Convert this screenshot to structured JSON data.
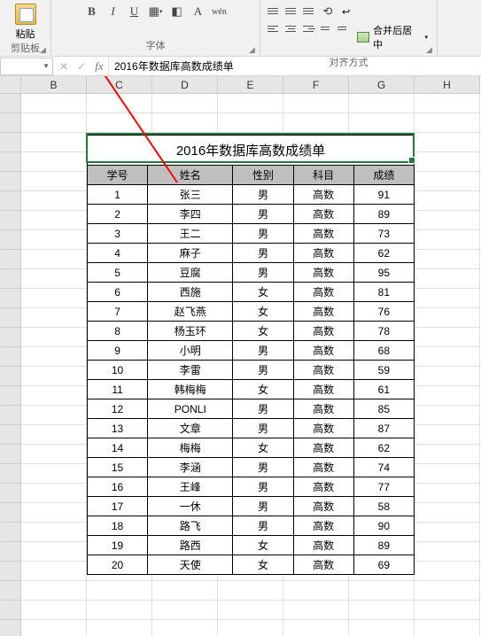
{
  "ribbon": {
    "clipboard": {
      "paste": "粘贴",
      "title": "剪贴板"
    },
    "font": {
      "title": "字体",
      "bold": "B",
      "italic": "I",
      "underline": "U"
    },
    "align": {
      "title": "对齐方式",
      "merge": "合并后居中"
    }
  },
  "formula_bar": {
    "cell_ref": "",
    "value": "2016年数据库高数成绩单"
  },
  "columns": [
    "B",
    "C",
    "D",
    "E",
    "F",
    "G",
    "H"
  ],
  "table": {
    "title": "2016年数据库高数成绩单",
    "headers": [
      "学号",
      "姓名",
      "性别",
      "科目",
      "成绩"
    ],
    "rows": [
      [
        "1",
        "张三",
        "男",
        "高数",
        "91"
      ],
      [
        "2",
        "李四",
        "男",
        "高数",
        "89"
      ],
      [
        "3",
        "王二",
        "男",
        "高数",
        "73"
      ],
      [
        "4",
        "麻子",
        "男",
        "高数",
        "62"
      ],
      [
        "5",
        "豆腐",
        "男",
        "高数",
        "95"
      ],
      [
        "6",
        "西施",
        "女",
        "高数",
        "81"
      ],
      [
        "7",
        "赵飞燕",
        "女",
        "高数",
        "76"
      ],
      [
        "8",
        "杨玉环",
        "女",
        "高数",
        "78"
      ],
      [
        "9",
        "小明",
        "男",
        "高数",
        "68"
      ],
      [
        "10",
        "李雷",
        "男",
        "高数",
        "59"
      ],
      [
        "11",
        "韩梅梅",
        "女",
        "高数",
        "61"
      ],
      [
        "12",
        "PONLI",
        "男",
        "高数",
        "85"
      ],
      [
        "13",
        "文章",
        "男",
        "高数",
        "87"
      ],
      [
        "14",
        "梅梅",
        "女",
        "高数",
        "62"
      ],
      [
        "15",
        "李涵",
        "男",
        "高数",
        "74"
      ],
      [
        "16",
        "王峰",
        "男",
        "高数",
        "77"
      ],
      [
        "17",
        "一休",
        "男",
        "高数",
        "58"
      ],
      [
        "18",
        "路飞",
        "男",
        "高数",
        "90"
      ],
      [
        "19",
        "路西",
        "女",
        "高数",
        "89"
      ],
      [
        "20",
        "天使",
        "女",
        "高数",
        "69"
      ]
    ]
  },
  "chart_data": {
    "type": "table",
    "title": "2016年数据库高数成绩单",
    "columns": [
      "学号",
      "姓名",
      "性别",
      "科目",
      "成绩"
    ],
    "rows": [
      [
        1,
        "张三",
        "男",
        "高数",
        91
      ],
      [
        2,
        "李四",
        "男",
        "高数",
        89
      ],
      [
        3,
        "王二",
        "男",
        "高数",
        73
      ],
      [
        4,
        "麻子",
        "男",
        "高数",
        62
      ],
      [
        5,
        "豆腐",
        "男",
        "高数",
        95
      ],
      [
        6,
        "西施",
        "女",
        "高数",
        81
      ],
      [
        7,
        "赵飞燕",
        "女",
        "高数",
        76
      ],
      [
        8,
        "杨玉环",
        "女",
        "高数",
        78
      ],
      [
        9,
        "小明",
        "男",
        "高数",
        68
      ],
      [
        10,
        "李雷",
        "男",
        "高数",
        59
      ],
      [
        11,
        "韩梅梅",
        "女",
        "高数",
        61
      ],
      [
        12,
        "PONLI",
        "男",
        "高数",
        85
      ],
      [
        13,
        "文章",
        "男",
        "高数",
        87
      ],
      [
        14,
        "梅梅",
        "女",
        "高数",
        62
      ],
      [
        15,
        "李涵",
        "男",
        "高数",
        74
      ],
      [
        16,
        "王峰",
        "男",
        "高数",
        77
      ],
      [
        17,
        "一休",
        "男",
        "高数",
        58
      ],
      [
        18,
        "路飞",
        "男",
        "高数",
        90
      ],
      [
        19,
        "路西",
        "女",
        "高数",
        89
      ],
      [
        20,
        "天使",
        "女",
        "高数",
        69
      ]
    ]
  }
}
